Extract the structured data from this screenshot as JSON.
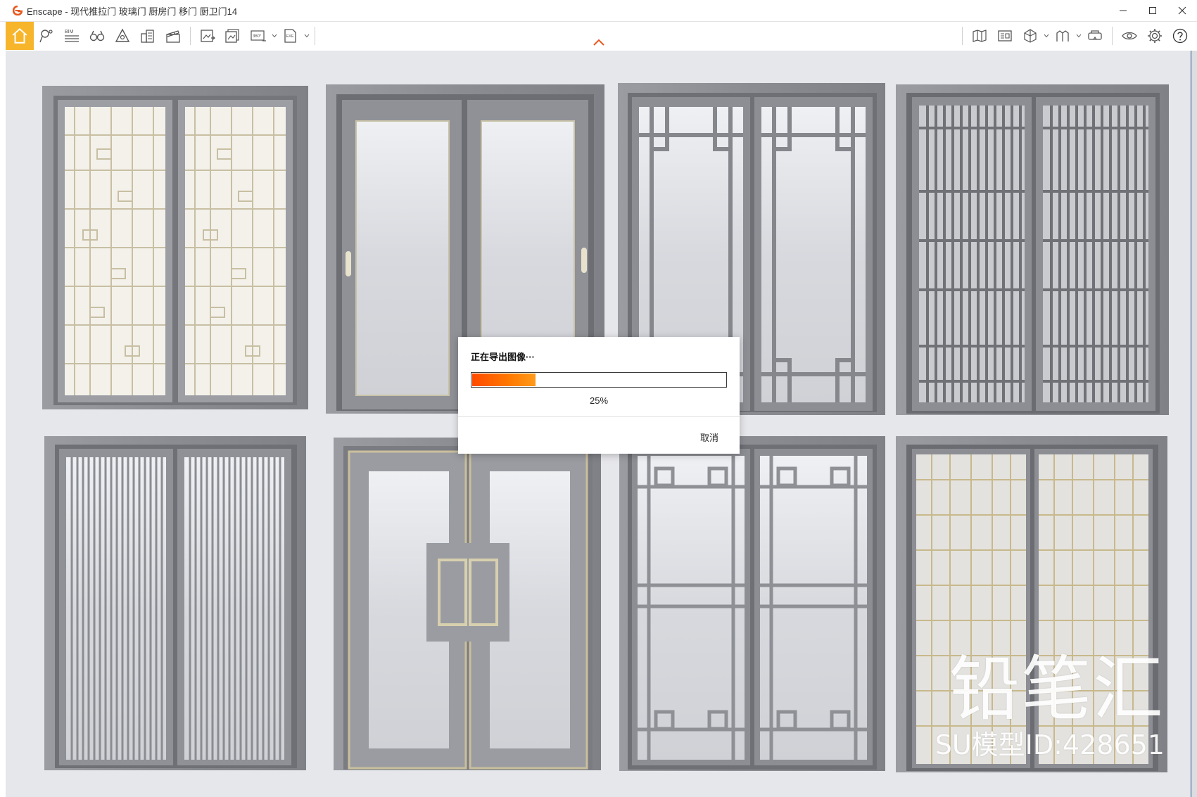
{
  "window": {
    "title": "Enscape - 现代推拉门 玻璃门 厨房门 移门 厨卫门14"
  },
  "toolbar": {
    "bim_label": "BIM",
    "pano_label": "360°",
    "exe_label": "EXE"
  },
  "viewport": {
    "watermark_brand": "铅笔汇",
    "watermark_id": "SU模型ID:428651"
  },
  "dialog": {
    "title": "正在导出图像···",
    "progress": 0.25,
    "progress_text": "25%",
    "cancel_label": "取消"
  },
  "colors": {
    "accent": "#f7b52c",
    "progress": "#ff6a00",
    "frame": "#8e9096",
    "glass": "#d4d6da",
    "brass": "#c9b98a"
  }
}
